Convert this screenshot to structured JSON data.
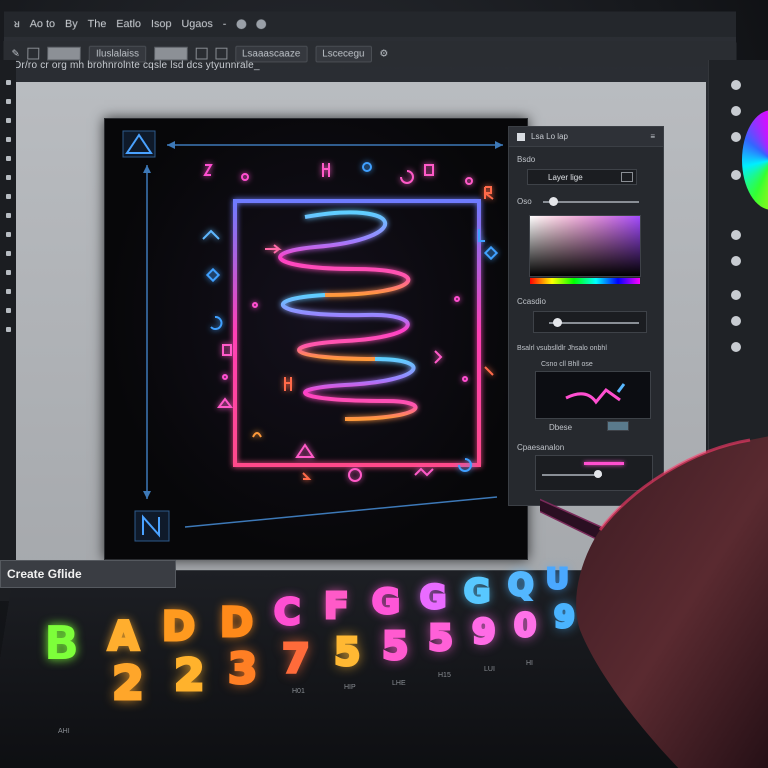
{
  "menubar": {
    "items": [
      "ᴚ",
      "Ao to",
      "By",
      "The",
      "Eatlo",
      "Isop",
      "Ugaos",
      "-"
    ]
  },
  "optionsbar": {
    "label1": "Iluslalaiss",
    "label2": "Lsaaascaaze",
    "label3": "Lscecegu"
  },
  "pathbar": {
    "text": "Dr/ro cr org mh brohnrolnte cqsle lsd dcs ytyunnrale_"
  },
  "props": {
    "title": "Lsa Lo lap",
    "section1": "Bsdo",
    "layer_field": "Layer lige",
    "opacity_label": "Oso",
    "section2": "Ccasdio",
    "section3": "Bsalrl vsubslldlr Jhsalo onbhl",
    "preview_label": "Csno cll Bhll ose",
    "blend_label": "Dbese",
    "section4": "Cpaesanalon"
  },
  "glyphpanel": {
    "title": "Create Gflide",
    "row1": [
      {
        "ch": "B",
        "color": "#7dff3a"
      },
      {
        "ch": "A",
        "color": "#ffae2e"
      },
      {
        "ch": "D",
        "color": "#ff9a1f"
      },
      {
        "ch": "D",
        "color": "#ff8a1a"
      },
      {
        "ch": "C",
        "color": "#ff4fd2"
      },
      {
        "ch": "F",
        "color": "#ff5ac8"
      },
      {
        "ch": "G",
        "color": "#ff56d8"
      },
      {
        "ch": "G",
        "color": "#e96bff"
      },
      {
        "ch": "G",
        "color": "#58c8ff"
      },
      {
        "ch": "Q",
        "color": "#53b7ff"
      },
      {
        "ch": "U",
        "color": "#4aa8ff"
      }
    ],
    "row2": [
      {
        "ch": "2",
        "color": "#ffa62a"
      },
      {
        "ch": "2",
        "color": "#ffb22c"
      },
      {
        "ch": "3",
        "color": "#ff7f24"
      },
      {
        "ch": "7",
        "color": "#ff6b3a"
      },
      {
        "ch": "5",
        "color": "#ffb833"
      },
      {
        "ch": "5",
        "color": "#ff5ad0"
      },
      {
        "ch": "5",
        "color": "#ff60d8"
      },
      {
        "ch": "9",
        "color": "#ff6be6"
      },
      {
        "ch": "0",
        "color": "#ff71e8"
      },
      {
        "ch": "9",
        "color": "#4ab4ff"
      }
    ],
    "captions": [
      "AHI",
      "H01",
      "HIP",
      "LHE",
      "H15",
      "LUI",
      "HI"
    ]
  }
}
